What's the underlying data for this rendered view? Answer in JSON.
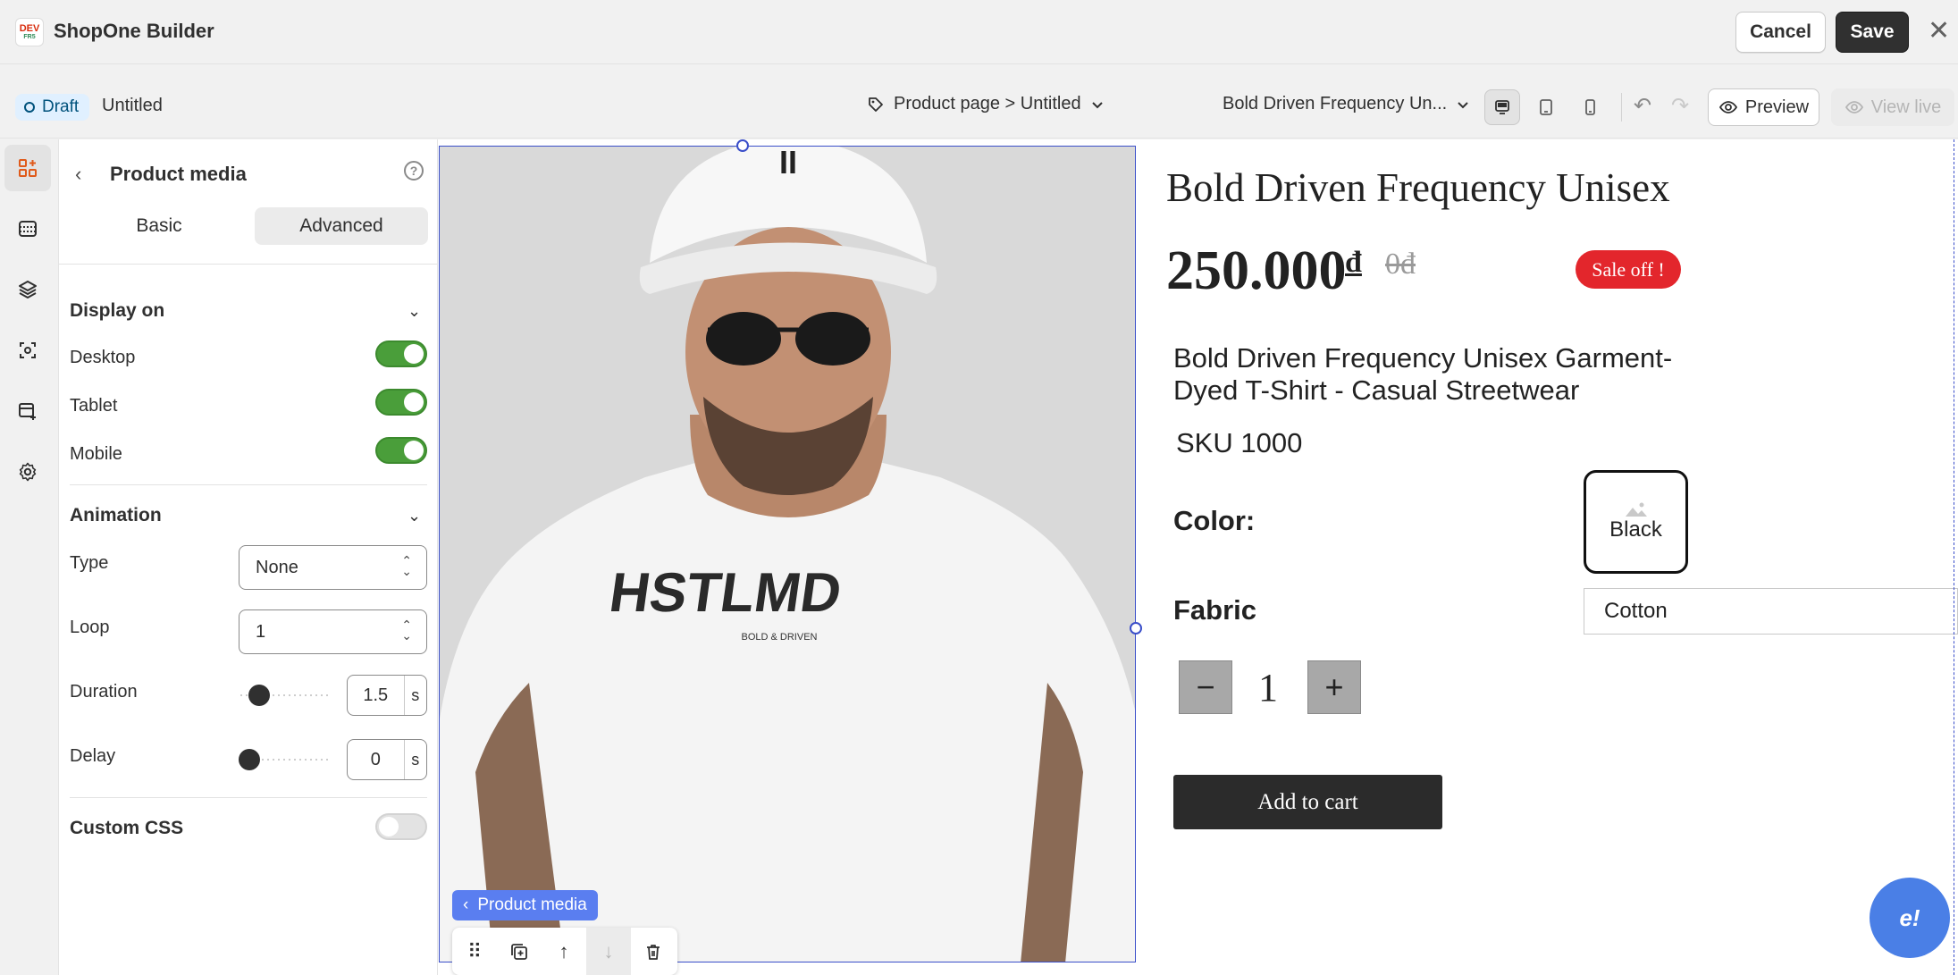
{
  "app": {
    "logo_text": "DEV",
    "logo_sub": "FR5",
    "title": "ShopOne Builder"
  },
  "header": {
    "cancel_label": "Cancel",
    "save_label": "Save",
    "close_icon": "close-icon"
  },
  "toolbar": {
    "status": "Draft",
    "page_name": "Untitled",
    "breadcrumb": "Product page > Untitled",
    "product_select": "Bold Driven Frequency Un...",
    "preview_label": "Preview",
    "view_live_label": "View live"
  },
  "panel": {
    "title": "Product media",
    "tabs": {
      "basic": "Basic",
      "advanced": "Advanced",
      "active": "Advanced"
    },
    "display_on": {
      "title": "Display on",
      "desktop": "Desktop",
      "tablet": "Tablet",
      "mobile": "Mobile",
      "desktop_on": true,
      "tablet_on": true,
      "mobile_on": true
    },
    "animation": {
      "title": "Animation",
      "type_label": "Type",
      "type_value": "None",
      "loop_label": "Loop",
      "loop_value": "1",
      "duration_label": "Duration",
      "duration_value": "1.5",
      "duration_unit": "s",
      "delay_label": "Delay",
      "delay_value": "0",
      "delay_unit": "s"
    },
    "custom_css": {
      "label": "Custom CSS",
      "on": false
    }
  },
  "product": {
    "title": "Bold Driven Frequency Unisex",
    "price": "250.000",
    "currency": "đ",
    "old_price": "0đ",
    "sale_badge": "Sale off !",
    "name": "Bold Driven Frequency Unisex Garment-Dyed T-Shirt - Casual Streetwear",
    "sku": "SKU 1000",
    "color_label": "Color:",
    "color_value": "Black",
    "fabric_label": "Fabric",
    "fabric_value": "Cotton",
    "quantity": "1",
    "add_to_cart": "Add to cart",
    "shirt_print": "HSTLMD",
    "shirt_sub": "BOLD & DRIVEN"
  },
  "canvas": {
    "media_tag": "Product media"
  },
  "colors": {
    "accent": "#3a4ec9",
    "toggle_on": "#4a9e3a",
    "sale": "#e3262c",
    "primary_btn": "#303030"
  }
}
